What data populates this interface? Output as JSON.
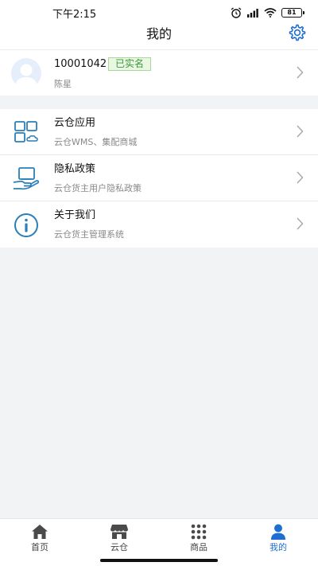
{
  "status_bar": {
    "time": "下午2:15",
    "battery": "81",
    "icons": [
      "alarm-icon",
      "signal-icon",
      "wifi-icon",
      "battery-icon"
    ]
  },
  "header": {
    "title": "我的",
    "settings_icon": "gear-icon"
  },
  "profile": {
    "user_id": "10001042",
    "badge": "已实名",
    "name": "陈星"
  },
  "menu": [
    {
      "title": "云仓应用",
      "subtitle": "云仓WMS、集配商城",
      "icon": "apps-grid-icon"
    },
    {
      "title": "隐私政策",
      "subtitle": "云仓货主用户隐私政策",
      "icon": "privacy-hand-icon"
    },
    {
      "title": "关于我们",
      "subtitle": "云仓货主管理系统",
      "icon": "info-icon"
    }
  ],
  "tabs": [
    {
      "label": "首页",
      "icon": "home-icon",
      "active": false
    },
    {
      "label": "云仓",
      "icon": "store-icon",
      "active": false
    },
    {
      "label": "商品",
      "icon": "dots-grid-icon",
      "active": false
    },
    {
      "label": "我的",
      "icon": "user-icon",
      "active": true
    }
  ],
  "colors": {
    "accent": "#1f6fd1",
    "badge_green": "#3a9a3a",
    "icon_blue": "#2b7fb8"
  }
}
